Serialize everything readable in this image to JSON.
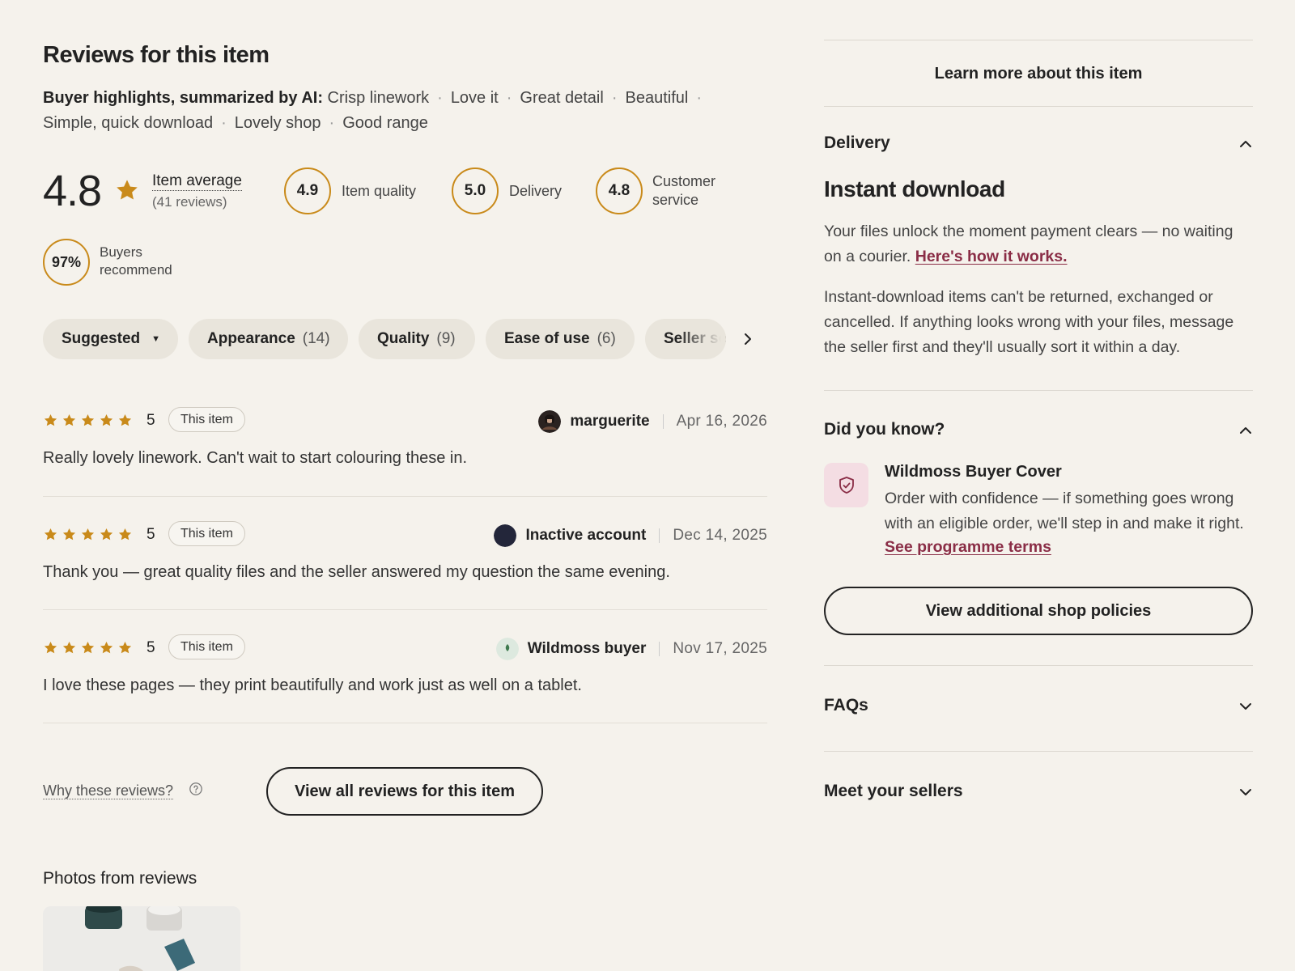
{
  "reviews_section": {
    "title": "Reviews for this item",
    "highlights_label": "Buyer highlights, summarized by AI:",
    "highlights": [
      "Crisp linework",
      "Love it",
      "Great detail",
      "Beautiful",
      "Simple, quick download",
      "Lovely shop",
      "Good range"
    ],
    "average_score": "4.8",
    "average_label": "Item average",
    "review_count": "(41 reviews)",
    "sub_ratings": [
      {
        "value": "4.9",
        "label": "Item quality"
      },
      {
        "value": "5.0",
        "label": "Delivery"
      },
      {
        "value": "4.8",
        "label_line1": "Customer",
        "label_line2": "service"
      }
    ],
    "recommend_pct": "97%",
    "recommend_line1": "Buyers",
    "recommend_line2": "recommend",
    "filters": [
      {
        "label": "Suggested",
        "count": ""
      },
      {
        "label": "Appearance",
        "count": "(14)"
      },
      {
        "label": "Quality",
        "count": "(9)"
      },
      {
        "label": "Ease of use",
        "count": "(6)"
      },
      {
        "label": "Seller service",
        "count": ""
      }
    ],
    "reviews": [
      {
        "rating": "5",
        "tag": "This item",
        "user": "marguerite",
        "date": "Apr 16, 2026",
        "text": "Really lovely linework. Can't wait to start colouring these in."
      },
      {
        "rating": "5",
        "tag": "This item",
        "user": "Inactive account",
        "date": "Dec 14, 2025",
        "text": "Thank you — great quality files and the seller answered my question the same evening."
      },
      {
        "rating": "5",
        "tag": "This item",
        "user": "Wildmoss buyer",
        "date": "Nov 17, 2025",
        "text": "I love these pages — they print beautifully and work just as well on a tablet."
      }
    ],
    "why_label": "Why these reviews?",
    "view_all_label": "View all reviews for this item",
    "photos_title": "Photos from reviews"
  },
  "sidebar": {
    "learn_more": "Learn more about this item",
    "delivery_heading": "Delivery",
    "instant_title": "Instant download",
    "delivery_text": "Your files unlock the moment payment clears — no waiting on a courier.",
    "delivery_link": "Here's how it works.",
    "returns_text": "Instant-download items can't be returned, exchanged or cancelled. If anything looks wrong with your files, message the seller first and they'll usually sort it within a day.",
    "did_you_know_heading": "Did you know?",
    "cover_title": "Wildmoss Buyer Cover",
    "cover_text": "Order with confidence — if something goes wrong with an eligible order, we'll step in and make it right.",
    "cover_link": "See programme terms",
    "policies_button": "View additional shop policies",
    "faqs_heading": "FAQs",
    "sellers_heading": "Meet your sellers"
  },
  "colors": {
    "star": "#c98a1a",
    "link": "#8a2d46",
    "background": "#f5f2ec",
    "pill": "#e9e5dc"
  },
  "icons": [
    "star-icon",
    "caret-down-icon",
    "chevron-right-icon",
    "help-circle-icon",
    "chevron-up-icon",
    "chevron-down-icon",
    "shield-check-icon"
  ]
}
